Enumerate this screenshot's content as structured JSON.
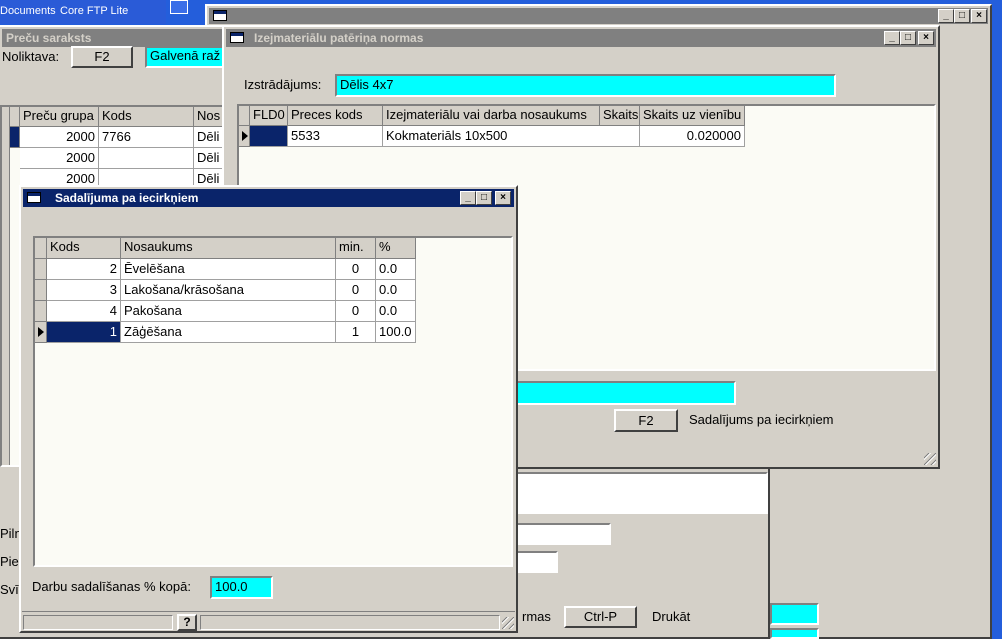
{
  "taskbar": {
    "items": [
      "Documents",
      "Core FTP Lite"
    ]
  },
  "preces_window": {
    "title": "Preču saraksts",
    "warehouse_label": "Noliktava:",
    "warehouse_key": "F2",
    "warehouse_value": "Galvenā raž",
    "columns": [
      "Preču grupa",
      "Kods",
      "Nos"
    ],
    "rows": [
      {
        "group": "2000",
        "code": "7766",
        "name": "Dēli"
      },
      {
        "group": "2000",
        "code": "",
        "name": "Dēli"
      },
      {
        "group": "2000",
        "code": "",
        "name": "Dēli"
      }
    ],
    "bottom_labels": [
      "Piln",
      "Piez",
      "Svītr"
    ],
    "bottom_right_label": "rmas",
    "print_key": "Ctrl-P",
    "print_label": "Drukāt"
  },
  "izej_window": {
    "title": "Izejmateriālu patēriņa normas",
    "product_label": "Izstrādājums:",
    "product_value": "Dēlis 4x7",
    "columns": [
      "FLD0",
      "Preces kods",
      "Izejmateriālu vai darba nosaukums",
      "Skaits",
      "Skaits uz vienību"
    ],
    "rows": [
      {
        "fld0": "",
        "code": "5533",
        "name": "Kokmateriāls 10x500",
        "count": "",
        "per_unit": "0.020000"
      }
    ],
    "split_key": "F2",
    "split_label": "Sadalījums pa iecirkņiem"
  },
  "sadal_window": {
    "title": "Sadalījuma pa iecirkņiem",
    "columns": [
      "Kods",
      "Nosaukums",
      "min.",
      "%"
    ],
    "rows": [
      {
        "kods": "2",
        "name": "Ēvelēšana",
        "min": "0",
        "pct": "0.0"
      },
      {
        "kods": "3",
        "name": "Lakošana/krāsošana",
        "min": "0",
        "pct": "0.0"
      },
      {
        "kods": "4",
        "name": "Pakošana",
        "min": "0",
        "pct": "0.0"
      },
      {
        "kods": "1",
        "name": "Zāģēšana",
        "min": "1",
        "pct": "100.0"
      }
    ],
    "total_label": "Darbu sadalīšanas % kopā:",
    "total_value": "100.0",
    "help_button": "?"
  },
  "colors": {
    "desktop": "#245edb",
    "active_title": "#0a246a",
    "field_cyan": "#00ffff"
  }
}
